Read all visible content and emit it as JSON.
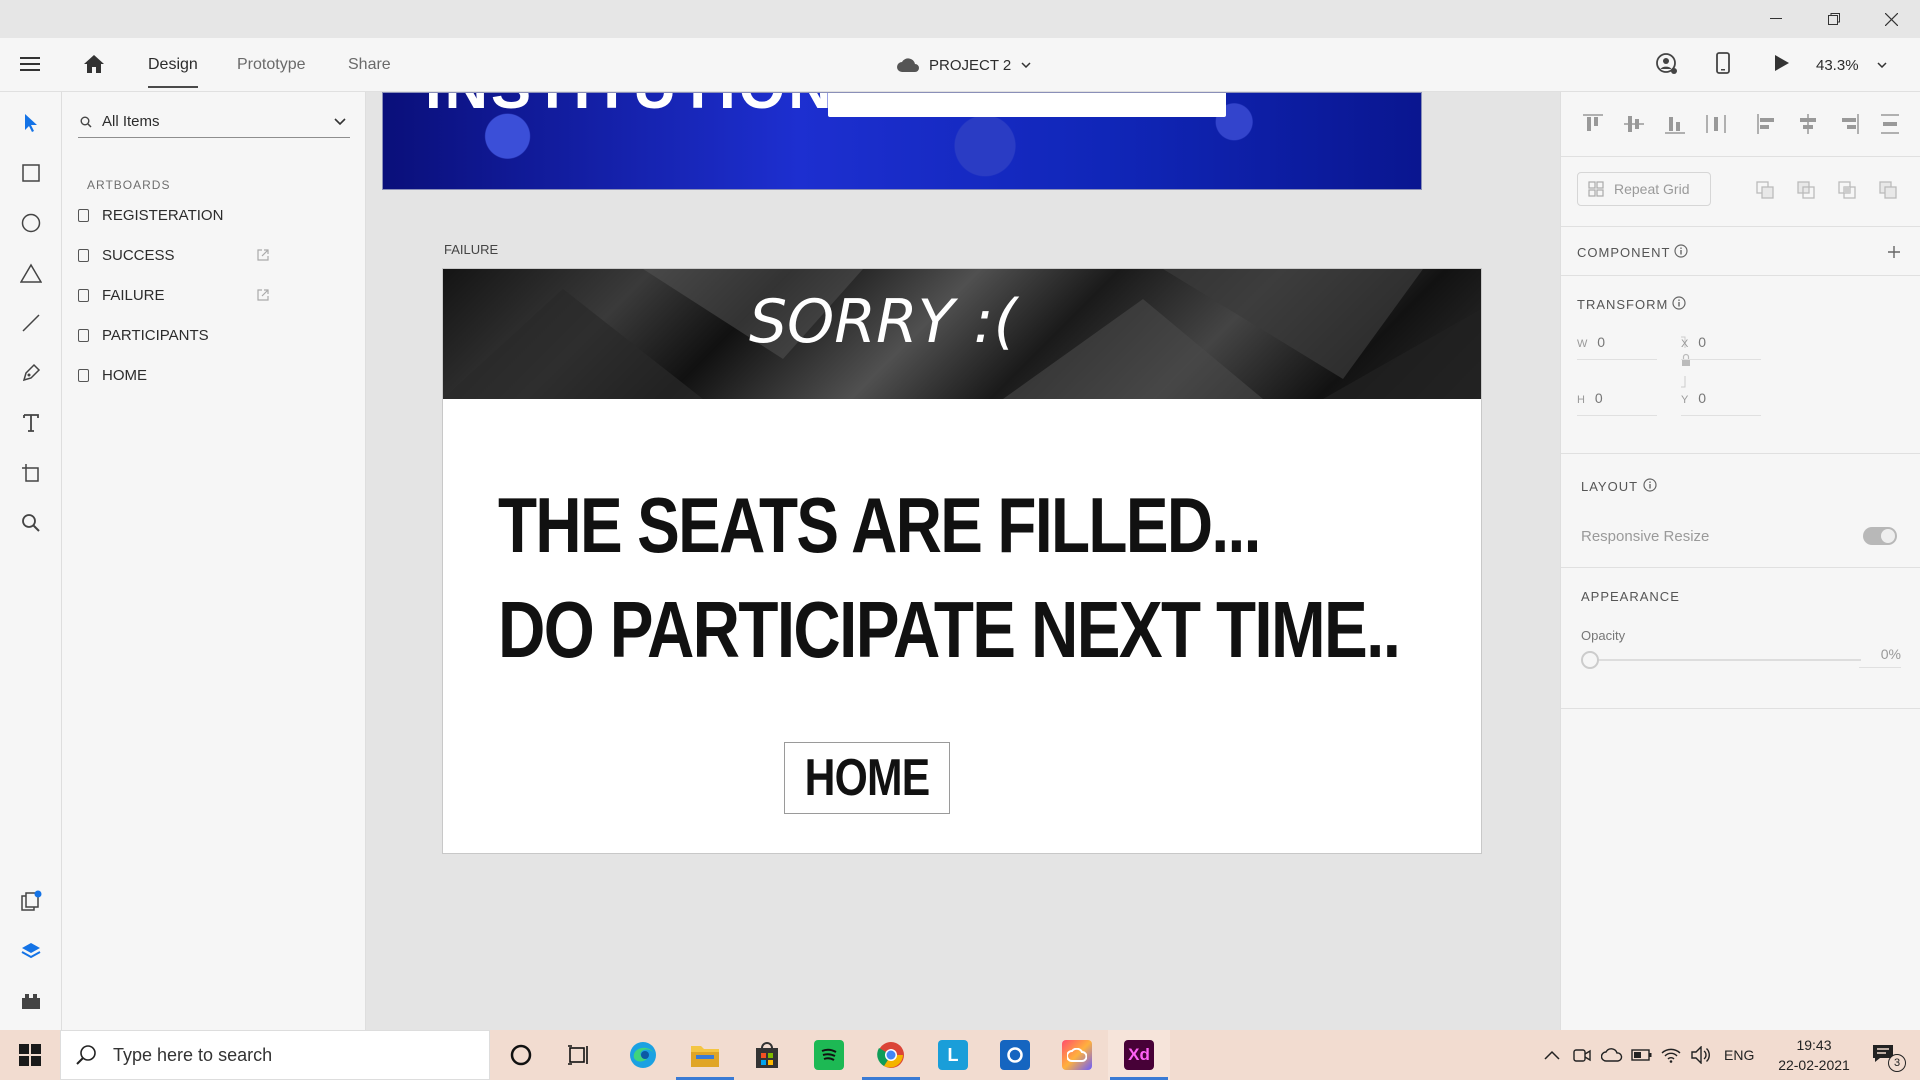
{
  "header": {
    "tabs": [
      "Design",
      "Prototype",
      "Share"
    ],
    "project_name": "PROJECT 2",
    "zoom": "43.3%"
  },
  "layers": {
    "filter_label": "All Items",
    "section_label": "ARTBOARDS",
    "items": [
      "REGISTERATION",
      "SUCCESS",
      "FAILURE",
      "PARTICIPANTS",
      "HOME"
    ]
  },
  "canvas": {
    "top_artboard_text": "INSTITUTION:",
    "artboard_label": "FAILURE",
    "banner_text": "SORRY :(",
    "message_line1": "THE SEATS ARE FILLED...",
    "message_line2": "DO PARTICIPATE NEXT TIME..",
    "home_button": "HOME"
  },
  "properties": {
    "repeat_grid": "Repeat Grid",
    "component_title": "COMPONENT",
    "transform_title": "TRANSFORM",
    "w_label": "W",
    "w_value": "0",
    "x_label": "X",
    "x_value": "0",
    "h_label": "H",
    "h_value": "0",
    "y_label": "Y",
    "y_value": "0",
    "layout_title": "LAYOUT",
    "responsive_resize": "Responsive Resize",
    "responsive_resize_on": true,
    "appearance_title": "APPEARANCE",
    "opacity_label": "Opacity",
    "opacity_value": "0%"
  },
  "taskbar": {
    "search_placeholder": "Type here to search",
    "language": "ENG",
    "time": "19:43",
    "date": "22-02-2021",
    "notification_count": "3"
  },
  "colors": {
    "accent": "#1473e6",
    "xd_brand": "#470137",
    "xd_text": "#ff61f6"
  }
}
